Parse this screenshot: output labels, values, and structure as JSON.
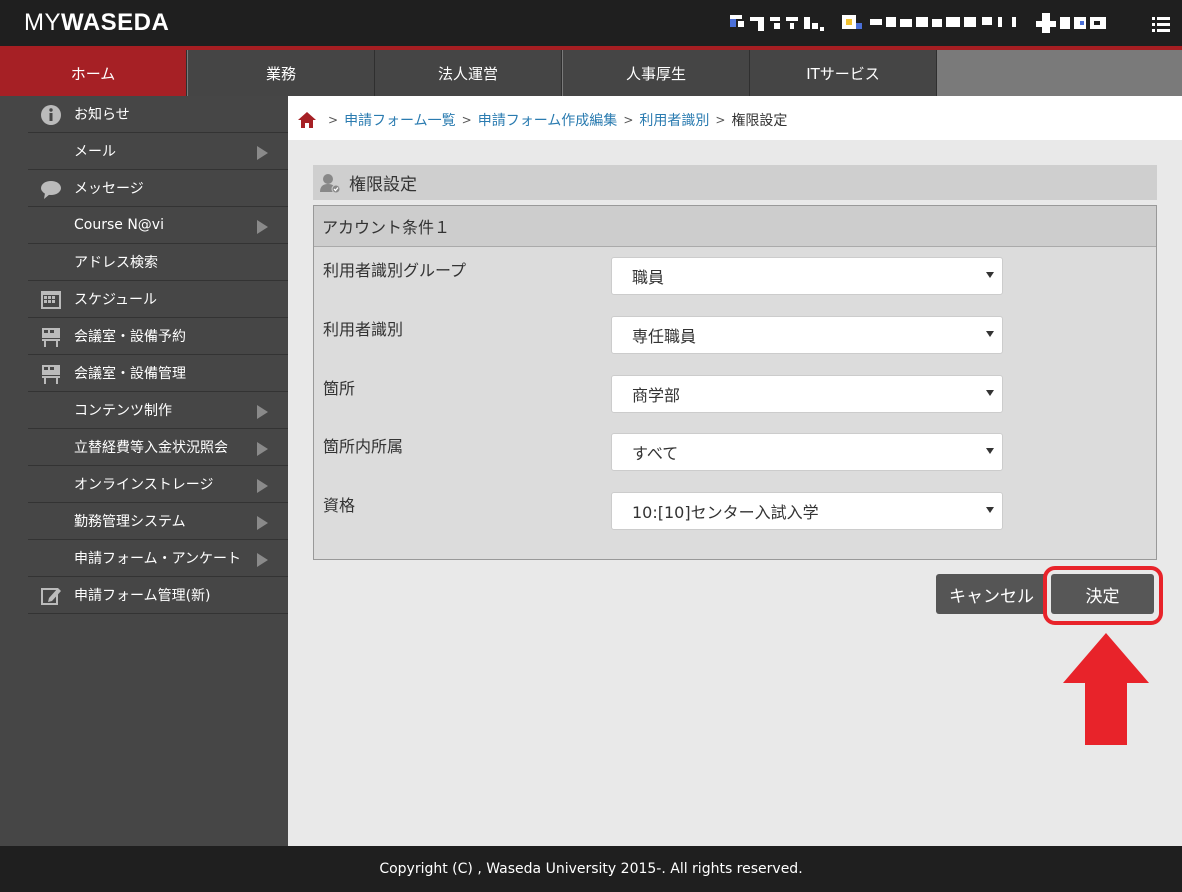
{
  "header": {
    "logo_my": "MY",
    "logo_waseda": "WASEDA"
  },
  "tabs": [
    {
      "label": "ホーム",
      "active": true
    },
    {
      "label": "業務",
      "active": false
    },
    {
      "label": "法人運営",
      "active": false
    },
    {
      "label": "人事厚生",
      "active": false
    },
    {
      "label": "ITサービス",
      "active": false
    }
  ],
  "sidebar": {
    "items": [
      {
        "label": "お知らせ",
        "icon": "info-icon",
        "arrow": false
      },
      {
        "label": "メール",
        "icon": "",
        "arrow": true
      },
      {
        "label": "メッセージ",
        "icon": "speech-bubble-icon",
        "arrow": false
      },
      {
        "label": "Course N@vi",
        "icon": "",
        "arrow": true
      },
      {
        "label": "アドレス検索",
        "icon": "",
        "arrow": false
      },
      {
        "label": "スケジュール",
        "icon": "calendar-icon",
        "arrow": false
      },
      {
        "label": "会議室・設備予約",
        "icon": "building-icon",
        "arrow": false
      },
      {
        "label": "会議室・設備管理",
        "icon": "building-icon",
        "arrow": false
      },
      {
        "label": "コンテンツ制作",
        "icon": "",
        "arrow": true
      },
      {
        "label": "立替経費等入金状況照会",
        "icon": "",
        "arrow": true
      },
      {
        "label": "オンラインストレージ",
        "icon": "",
        "arrow": true
      },
      {
        "label": "勤務管理システム",
        "icon": "",
        "arrow": true
      },
      {
        "label": "申請フォーム・アンケート",
        "icon": "",
        "arrow": true
      },
      {
        "label": "申請フォーム管理(新)",
        "icon": "edit-icon",
        "arrow": false
      }
    ]
  },
  "breadcrumb": {
    "items": [
      "申請フォーム一覧",
      "申請フォーム作成編集",
      "利用者識別"
    ],
    "current": "権限設定",
    "separator": ">"
  },
  "section": {
    "title": "権限設定"
  },
  "panel": {
    "title": "アカウント条件１",
    "fields": [
      {
        "label": "利用者識別グループ",
        "value": "職員"
      },
      {
        "label": "利用者識別",
        "value": "専任職員"
      },
      {
        "label": "箇所",
        "value": "商学部"
      },
      {
        "label": "箇所内所属",
        "value": "すべて"
      },
      {
        "label": "資格",
        "value": "10:[10]センター入試入学"
      }
    ]
  },
  "buttons": {
    "cancel": "キャンセル",
    "ok": "決定"
  },
  "footer": {
    "copyright": "Copyright (C) , Waseda University 2015-. All rights reserved."
  },
  "colors": {
    "accent_red": "#a62025",
    "annotation_red": "#e8232a",
    "link": "#2a7bb0"
  }
}
